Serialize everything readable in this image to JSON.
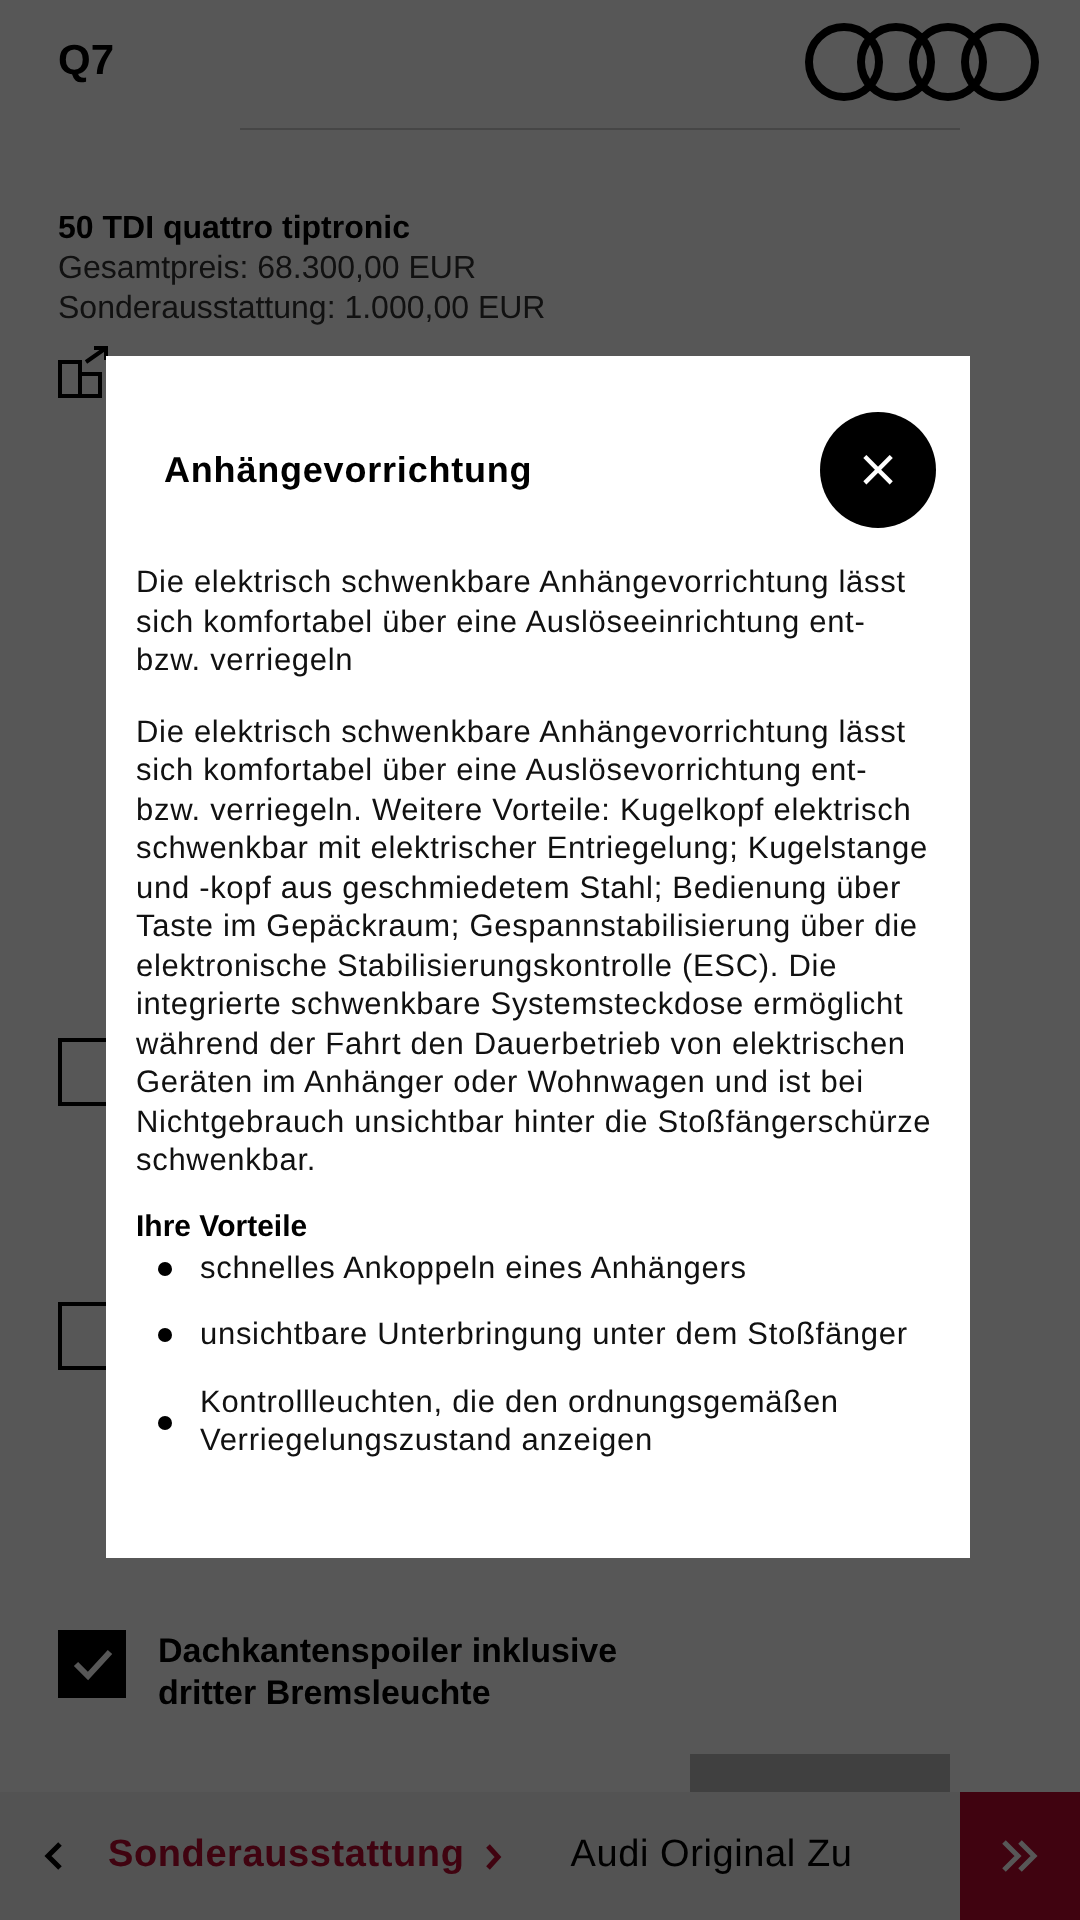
{
  "header": {
    "title": "Q7"
  },
  "summary": {
    "model": "50 TDI quattro tiptronic",
    "total_price": "Gesamtpreis: 68.300,00 EUR",
    "options_price": "Sonderausstattung: 1.000,00 EUR"
  },
  "options": [
    {
      "checked": false
    },
    {
      "checked": false
    },
    {
      "name": "Dachkantenspoiler inklusive dritter Bremsleuchte",
      "checked": true
    }
  ],
  "bottom_nav": {
    "items": [
      {
        "label": "Sonderausstattung",
        "selected": true
      },
      {
        "label": "Audi Original Zu",
        "selected": false
      }
    ]
  },
  "dialog": {
    "title": "Anhängevorrichtung",
    "close": "×",
    "paragraphs": [
      "Die elektrisch schwenkbare Anhängevorrichtung lässt sich komfortabel über eine Auslöseeinrichtung ent- bzw. verriegeln",
      "Die elektrisch schwenkbare Anhängevorrichtung lässt sich komfortabel über eine Auslösevorrichtung ent- bzw. verriegeln. Weitere Vorteile: Kugelkopf elektrisch schwenkbar mit elektrischer Entriegelung; Kugelstange und -kopf aus geschmiedetem Stahl; Bedienung über Taste im Gepäckraum; Gespannstabilisierung über die elektronische Stabilisierungskontrolle (ESC). Die integrierte schwenkbare Systemsteckdose ermöglicht während der Fahrt den Dauerbetrieb von elektrischen Geräten im Anhänger oder Wohnwagen und ist bei Nichtgebrauch unsichtbar hinter die Stoßfängerschürze schwenkbar."
    ],
    "benefits_title": "Ihre Vorteile",
    "benefits": [
      "schnelles Ankoppeln eines Anhängers",
      "unsichtbare Unterbringung unter dem Stoßfänger",
      "Kontrollleuchten, die den ordnungsgemäßen Verriegelungszustand anzeigen"
    ]
  }
}
